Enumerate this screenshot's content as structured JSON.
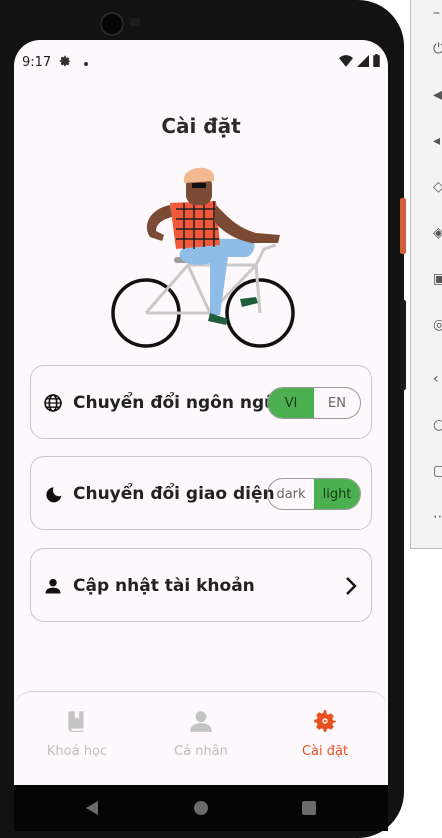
{
  "status_bar": {
    "time": "9:17"
  },
  "page": {
    "title": "Cài đặt"
  },
  "settings": {
    "language": {
      "label": "Chuyển đổi ngôn ngữ",
      "options": [
        "VI",
        "EN"
      ],
      "selected": "VI"
    },
    "theme": {
      "label": "Chuyển đổi giao diện",
      "options": [
        "dark",
        "light"
      ],
      "selected": "light"
    },
    "account": {
      "label": "Cập nhật tài khoản"
    }
  },
  "bottom_nav": {
    "items": [
      {
        "label": "Khoá học",
        "icon": "book-icon",
        "active": false
      },
      {
        "label": "Cá nhân",
        "icon": "person-icon",
        "active": false
      },
      {
        "label": "Cài đặt",
        "icon": "settings-icon",
        "active": true
      }
    ]
  },
  "colors": {
    "accent_green": "#4caf50",
    "active_nav": "#e8501f",
    "inactive_nav": "#bdbdbd"
  }
}
